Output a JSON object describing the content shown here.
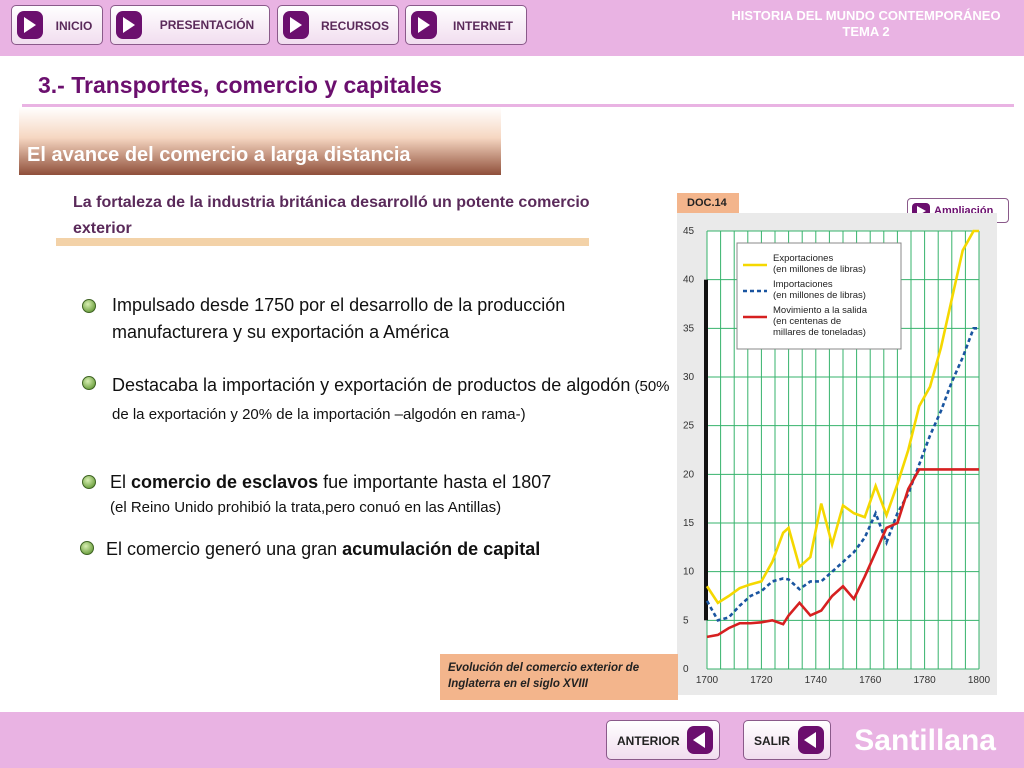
{
  "nav": {
    "inicio": "INICIO",
    "presentacion": "PRESENTACIÓN",
    "recursos": "RECURSOS",
    "internet": "INTERNET"
  },
  "brand": {
    "line1": "HISTORIA DEL MUNDO CONTEMPORÁNEO",
    "line2": "TEMA 2"
  },
  "page_title": "3.- Transportes, comercio y capitales",
  "section_title": "El avance del comercio a larga distancia",
  "intro": "La fortaleza de la industria británica desarrolló un potente comercio exterior",
  "bullets": {
    "b1": "Impulsado desde 1750 por el desarrollo de la producción manufacturera y su exportación a América",
    "b2_main": "Destacaba la importación y exportación de productos de algodón",
    "b2_small": " (50% de la exportación y 20% de la importación –algodón en rama-)",
    "b3_pre": "El ",
    "b3_bold": "comercio de esclavos",
    "b3_post": " fue importante hasta el 1807",
    "b3_sub": "(el Reino Unido prohibió la trata,pero conuó en las Antillas)",
    "b4_pre": "El comercio generó una gran ",
    "b4_bold": "acumulación de capital"
  },
  "doc_tag": "DOC.14",
  "ampliacion": "Ampliación",
  "caption": "Evolución del comercio exterior de Inglaterra en el siglo XVIII",
  "bottom": {
    "anterior": "ANTERIOR",
    "salir": "SALIR",
    "logo": "Santillana"
  },
  "colors": {
    "accent": "#6b0f6e",
    "bar": "#e9b3e3",
    "tag": "#f3b58c"
  },
  "chart_data": {
    "type": "line",
    "xlim": [
      1700,
      1800
    ],
    "ylim": [
      0,
      45
    ],
    "xticks": [
      1700,
      1720,
      1740,
      1760,
      1780,
      1800
    ],
    "yticks": [
      0,
      5,
      10,
      15,
      20,
      25,
      30,
      35,
      40,
      45
    ],
    "grid": true,
    "legend": "top-left",
    "series": [
      {
        "name": "Exportaciones\n(en millones de libras)",
        "color": "#f5d800",
        "dash": false,
        "x": [
          1700,
          1704,
          1708,
          1712,
          1716,
          1720,
          1724,
          1728,
          1730,
          1734,
          1738,
          1742,
          1746,
          1750,
          1754,
          1758,
          1762,
          1766,
          1770,
          1774,
          1778,
          1782,
          1786,
          1790,
          1794,
          1798,
          1800
        ],
        "y": [
          8.5,
          6.8,
          7.5,
          8.3,
          8.7,
          9,
          11,
          14,
          14.5,
          10.5,
          11.5,
          17,
          12.8,
          16.8,
          16,
          15.6,
          18.8,
          15.8,
          19,
          22.5,
          27,
          29,
          33,
          38,
          43,
          45,
          45
        ]
      },
      {
        "name": "Importaciones\n(en millones de libras)",
        "color": "#1a55a0",
        "dash": true,
        "x": [
          1700,
          1704,
          1708,
          1712,
          1716,
          1720,
          1724,
          1728,
          1730,
          1734,
          1738,
          1742,
          1746,
          1750,
          1754,
          1758,
          1762,
          1766,
          1770,
          1774,
          1778,
          1782,
          1786,
          1790,
          1794,
          1798,
          1800
        ],
        "y": [
          7,
          5,
          5.3,
          6.5,
          7.5,
          8,
          9,
          9.3,
          9.2,
          8.2,
          9,
          9,
          10,
          11,
          12,
          13.5,
          16,
          13,
          16,
          18,
          21,
          24,
          26.5,
          29.5,
          32,
          35,
          35
        ]
      },
      {
        "name": "Movimiento a la salida\n(en centenas de\nmillares de toneladas)",
        "color": "#d62020",
        "dash": false,
        "x": [
          1700,
          1704,
          1708,
          1712,
          1716,
          1720,
          1724,
          1728,
          1730,
          1734,
          1738,
          1742,
          1746,
          1750,
          1754,
          1758,
          1762,
          1766,
          1770,
          1774,
          1778,
          1782,
          1786,
          1790,
          1794,
          1798,
          1800
        ],
        "y": [
          3.3,
          3.5,
          4.2,
          4.7,
          4.7,
          4.8,
          5.0,
          4.6,
          5.5,
          6.8,
          5.5,
          6.0,
          7.5,
          8.5,
          7.2,
          9.5,
          12,
          14.5,
          15,
          18.5,
          20.5,
          20.5,
          20.5,
          20.5,
          20.5,
          20.5,
          20.5
        ]
      }
    ]
  }
}
